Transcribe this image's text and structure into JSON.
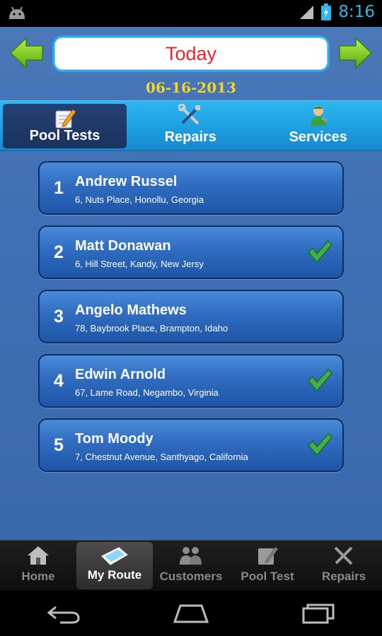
{
  "status_bar": {
    "time": "8:16"
  },
  "header": {
    "day_label": "Today",
    "date": "06-16-2013"
  },
  "tabs": [
    {
      "label": "Pool Tests",
      "icon": "pencil-note-icon",
      "active": true
    },
    {
      "label": "Repairs",
      "icon": "tools-icon",
      "active": false
    },
    {
      "label": "Services",
      "icon": "worker-icon",
      "active": false
    }
  ],
  "route_items": [
    {
      "number": "1",
      "name": "Andrew Russel",
      "address": "6, Nuts Place, Honollu, Georgia",
      "done": false
    },
    {
      "number": "2",
      "name": "Matt Donawan",
      "address": "6, Hill Street, Kandy, New Jersy",
      "done": true
    },
    {
      "number": "3",
      "name": "Angelo Mathews",
      "address": "78, Baybrook Place, Brampton, Idaho",
      "done": false
    },
    {
      "number": "4",
      "name": "Edwin Arnold",
      "address": "67, Lame Road, Negambo, Virginia",
      "done": true
    },
    {
      "number": "5",
      "name": "Tom Moody",
      "address": "7, Chestnut Avenue, Santhyago, California",
      "done": true
    }
  ],
  "bottom_nav": [
    {
      "label": "Home",
      "icon": "home-icon",
      "active": false
    },
    {
      "label": "My Route",
      "icon": "pool-icon",
      "active": true
    },
    {
      "label": "Customers",
      "icon": "people-icon",
      "active": false
    },
    {
      "label": "Pool Test",
      "icon": "pencil-note-icon",
      "active": false
    },
    {
      "label": "Repairs",
      "icon": "tools-icon",
      "active": false
    }
  ],
  "colors": {
    "accent_green": "#79c91c",
    "date_yellow": "#f5d327",
    "day_red": "#e8242c",
    "tab_blue": "#1e9fe2"
  }
}
